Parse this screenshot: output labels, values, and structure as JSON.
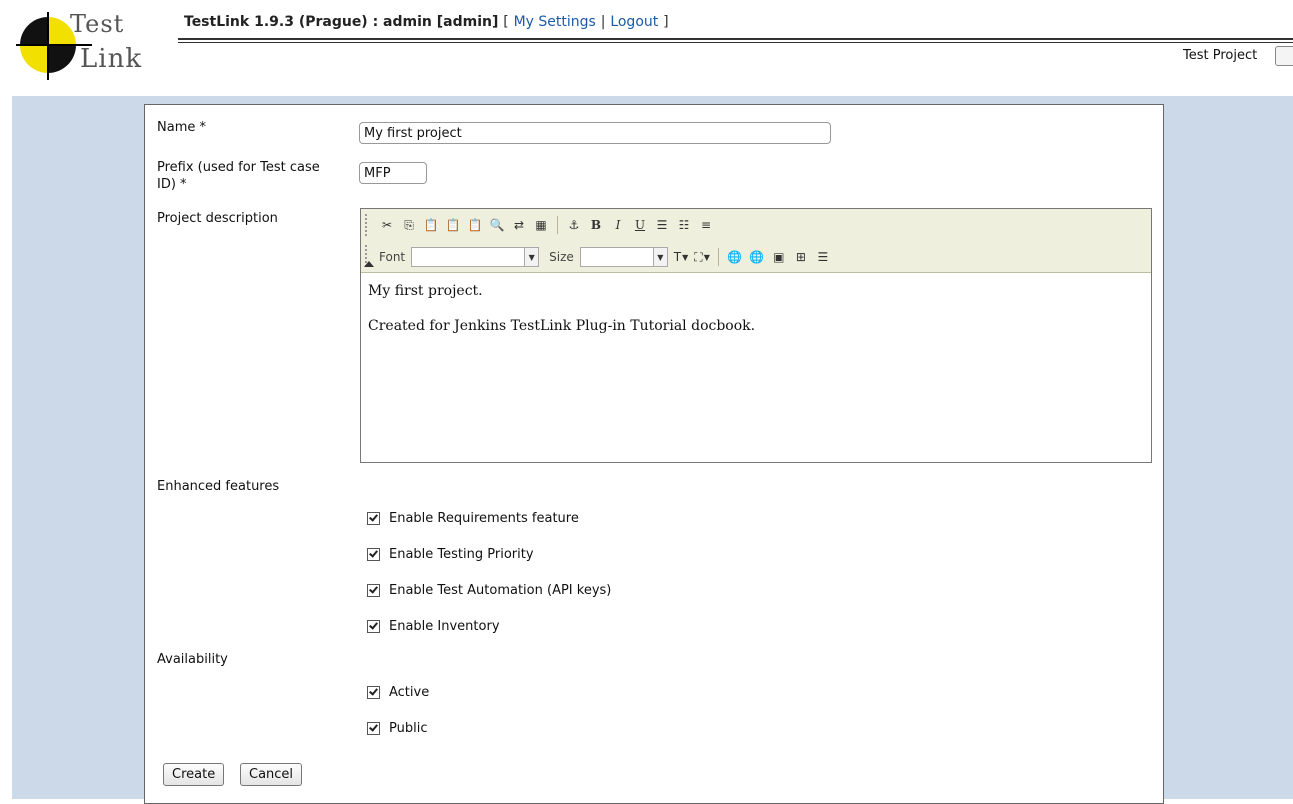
{
  "logo": {
    "line1": "Test",
    "line2": "Link"
  },
  "header": {
    "app_title": "TestLink 1.9.3 (Prague) : admin [admin]",
    "bracket_open": "[",
    "my_settings": "My Settings",
    "separator": "|",
    "logout": "Logout",
    "bracket_close": "]",
    "test_project_label": "Test Project"
  },
  "form": {
    "name_label": "Name *",
    "name_value": "My first project",
    "prefix_label_line1": "Prefix (used for Test case",
    "prefix_label_line2": "ID) *",
    "prefix_value": "MFP",
    "description_label": "Project description",
    "enhanced_label": "Enhanced features",
    "availability_label": "Availability"
  },
  "editor": {
    "font_label": "Font",
    "size_label": "Size",
    "bold": "B",
    "italic": "I",
    "underline": "U",
    "content": [
      "My first project.",
      "Created for Jenkins TestLink Plug-in Tutorial docbook."
    ]
  },
  "enhanced_features": [
    {
      "label": "Enable Requirements feature",
      "checked": true
    },
    {
      "label": "Enable Testing Priority",
      "checked": true
    },
    {
      "label": "Enable Test Automation (API keys)",
      "checked": true
    },
    {
      "label": "Enable Inventory",
      "checked": true
    }
  ],
  "availability": [
    {
      "label": "Active",
      "checked": true
    },
    {
      "label": "Public",
      "checked": true
    }
  ],
  "buttons": {
    "create": "Create",
    "cancel": "Cancel"
  },
  "colors": {
    "link": "#1d5aa7",
    "page_background": "#ccd9e9",
    "toolbar_background": "#efefde",
    "logo_yellow": "#f2e000"
  }
}
